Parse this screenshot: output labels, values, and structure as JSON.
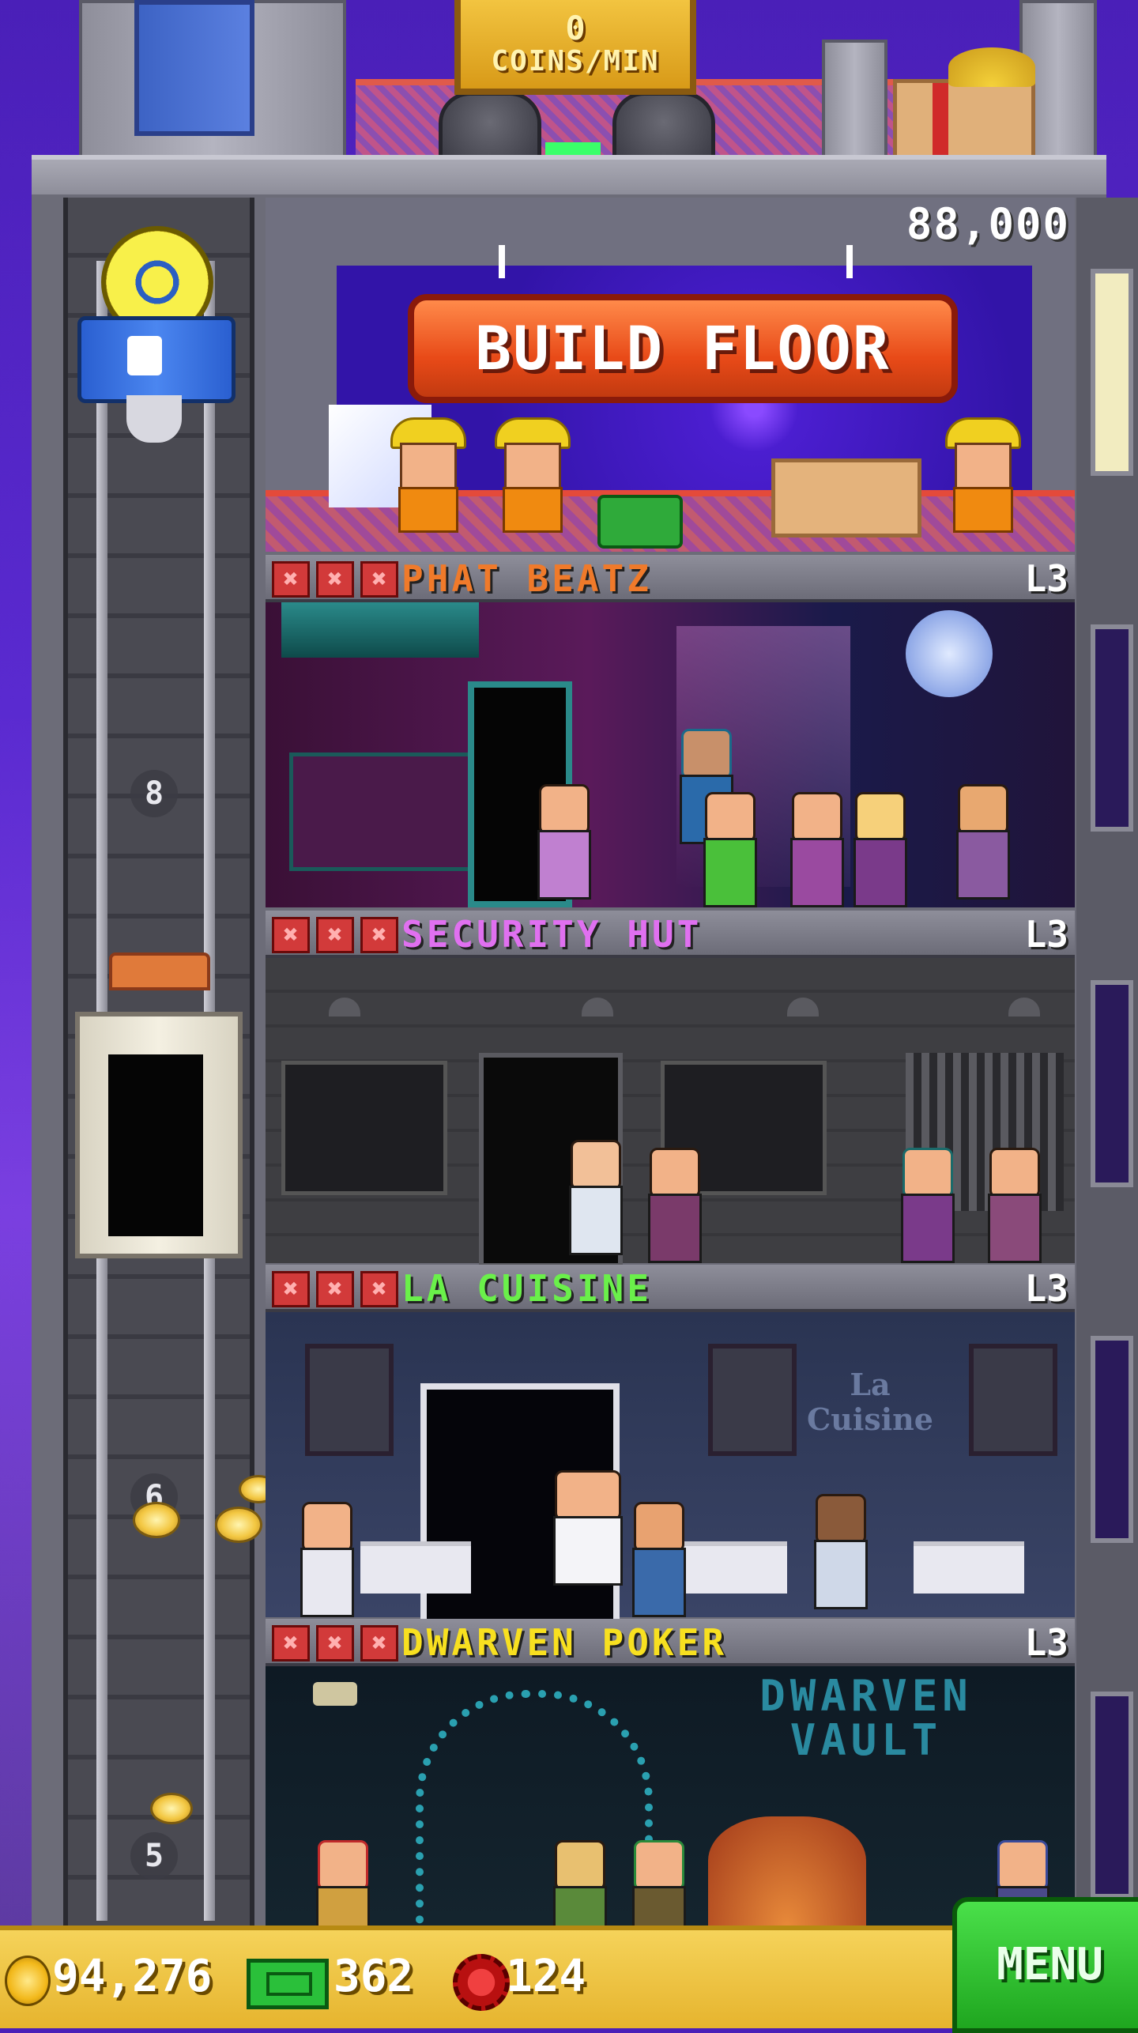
{
  "roof": {
    "coins_per_min_value": "0",
    "coins_per_min_label": "COINS/MIN"
  },
  "build_floor": {
    "price": "88,000",
    "button_label": "BUILD FLOOR"
  },
  "elevator": {
    "floor_numbers": [
      "8",
      "6",
      "5"
    ]
  },
  "floors": [
    {
      "name": "PHAT BEATZ",
      "level": "L3",
      "name_color": "#f07a2a",
      "stock_marks": [
        "✖",
        "✖",
        "✖"
      ]
    },
    {
      "name": "SECURITY HUT",
      "level": "L3",
      "name_color": "#e070f0",
      "stock_marks": [
        "✖",
        "✖",
        "✖"
      ]
    },
    {
      "name": "LA CUISINE",
      "level": "L3",
      "name_color": "#6af04a",
      "stock_marks": [
        "✖",
        "✖",
        "✖"
      ]
    },
    {
      "name": "DWARVEN POKER",
      "level": "L3",
      "name_color": "#f8e020",
      "stock_marks": [
        "✖",
        "✖",
        "✖"
      ]
    }
  ],
  "scene_text": {
    "cuisine_sign": "La Cuisine",
    "dwarven_sign_line1": "DWARVEN",
    "dwarven_sign_line2": "VAULT"
  },
  "bottom_bar": {
    "coins": "94,276",
    "tower_bux": "362",
    "chips": "124",
    "menu_label": "MENU"
  },
  "icons": {
    "coin": "coin-icon",
    "bux": "bux-icon",
    "chip": "chip-icon"
  }
}
